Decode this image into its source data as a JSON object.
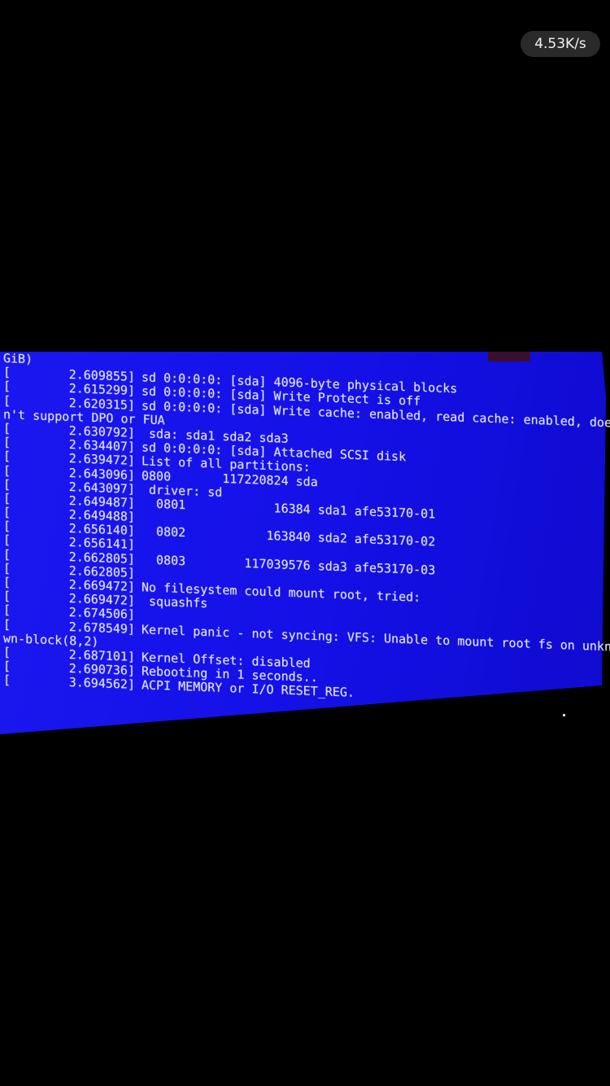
{
  "status_bar": {
    "download_speed": "4.53K/s"
  },
  "console": {
    "lines": [
      {
        "text": "GiB)"
      },
      {
        "bracket": "[",
        "ts": "2.609855]",
        "msg": "sd 0:0:0:0: [sda] 4096-byte physical blocks"
      },
      {
        "bracket": "[",
        "ts": "2.615299]",
        "msg": "sd 0:0:0:0: [sda] Write Protect is off"
      },
      {
        "bracket": "[",
        "ts": "2.620315]",
        "msg": "sd 0:0:0:0: [sda] Write cache: enabled, read cache: enabled, does"
      },
      {
        "text": "n't support DPO or FUA"
      },
      {
        "bracket": "[",
        "ts": "2.630792]",
        "msg": " sda: sda1 sda2 sda3"
      },
      {
        "bracket": "[",
        "ts": "2.634407]",
        "msg": "sd 0:0:0:0: [sda] Attached SCSI disk"
      },
      {
        "bracket": "[",
        "ts": "2.639472]",
        "msg": "List of all partitions:"
      },
      {
        "bracket": "[",
        "ts": "2.643096]",
        "msg": "0800       117220824 sda"
      },
      {
        "bracket": "[",
        "ts": "2.643097]",
        "msg": " driver: sd"
      },
      {
        "bracket": "[",
        "ts": "2.649487]",
        "msg": "  0801            16384 sda1 afe53170-01"
      },
      {
        "bracket": "[",
        "ts": "2.649488]",
        "msg": ""
      },
      {
        "bracket": "[",
        "ts": "2.656140]",
        "msg": "  0802           163840 sda2 afe53170-02"
      },
      {
        "bracket": "[",
        "ts": "2.656141]",
        "msg": ""
      },
      {
        "bracket": "[",
        "ts": "2.662805]",
        "msg": "  0803        117039576 sda3 afe53170-03"
      },
      {
        "bracket": "[",
        "ts": "2.662805]",
        "msg": ""
      },
      {
        "bracket": "[",
        "ts": "2.669472]",
        "msg": "No filesystem could mount root, tried:"
      },
      {
        "bracket": "[",
        "ts": "2.669472]",
        "msg": " squashfs"
      },
      {
        "bracket": "[",
        "ts": "2.674506]",
        "msg": ""
      },
      {
        "bracket": "[",
        "ts": "2.678549]",
        "msg": "Kernel panic - not syncing: VFS: Unable to mount root fs on unkno"
      },
      {
        "text": "wn-block(8,2)"
      },
      {
        "bracket": "[",
        "ts": "2.687101]",
        "msg": "Kernel Offset: disabled"
      },
      {
        "bracket": "[",
        "ts": "2.690736]",
        "msg": "Rebooting in 1 seconds.."
      },
      {
        "bracket": "[",
        "ts": "3.694562]",
        "msg": "ACPI MEMORY or I/O RESET_REG."
      }
    ]
  },
  "colors": {
    "screen_blue": "#1612e8",
    "console_text": "#dfe2ff",
    "background": "#000000",
    "badge_bg": "#2a2a2a"
  }
}
